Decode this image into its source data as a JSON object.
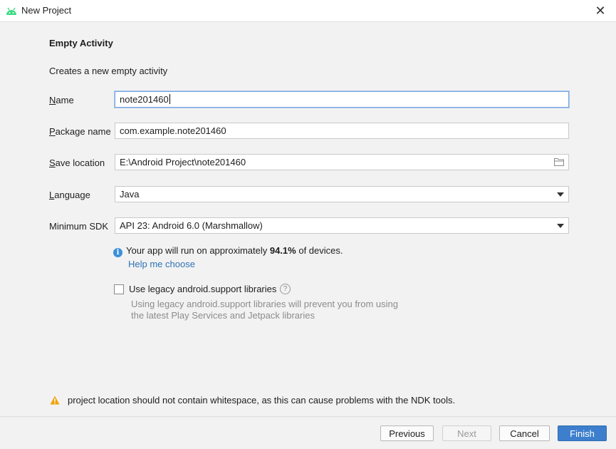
{
  "window": {
    "title": "New Project"
  },
  "header": {
    "heading": "Empty Activity",
    "description": "Creates a new empty activity"
  },
  "form": {
    "name": {
      "label_first": "N",
      "label_rest": "ame",
      "value": "note201460"
    },
    "package": {
      "label_first": "P",
      "label_rest": "ackage name",
      "value": "com.example.note201460"
    },
    "save_location": {
      "label_first": "S",
      "label_rest": "ave location",
      "value": "E:\\Android Project\\note201460"
    },
    "language": {
      "label_first": "L",
      "label_rest": "anguage",
      "value": "Java"
    },
    "min_sdk": {
      "label": "Minimum SDK",
      "value": "API 23: Android 6.0 (Marshmallow)"
    }
  },
  "info": {
    "text_before": "Your app will run on approximately ",
    "percent": "94.1%",
    "text_after": " of devices.",
    "link": "Help me choose"
  },
  "legacy": {
    "label": "Use legacy android.support libraries",
    "hint_line1": "Using legacy android.support libraries will prevent you from using",
    "hint_line2": "the latest Play Services and Jetpack libraries"
  },
  "warning": {
    "text": "project location should not contain whitespace, as this can cause problems with the NDK tools."
  },
  "footer": {
    "previous": "Previous",
    "next": "Next",
    "cancel": "Cancel",
    "finish": "Finish"
  },
  "colors": {
    "accent": "#3d7fcc",
    "link": "#2f73b6",
    "warning": "#f0a30a",
    "android": "#3ddc84"
  }
}
